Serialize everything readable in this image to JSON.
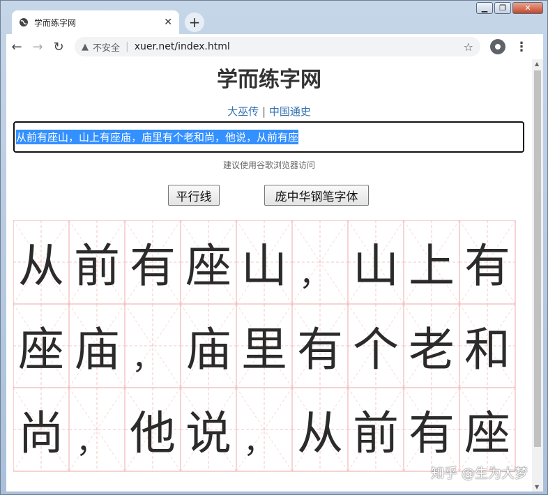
{
  "tab": {
    "title": "学而练字网",
    "close_glyph": "✕"
  },
  "newtab_glyph": "+",
  "window_controls": {
    "minimize": "▁",
    "maximize": "❐",
    "close": "✕"
  },
  "toolbar": {
    "back_glyph": "←",
    "forward_glyph": "→",
    "reload_glyph": "↻",
    "warn_glyph": "▲",
    "insecure_label": "不安全",
    "url": "xuer.net/index.html",
    "star_glyph": "☆",
    "menu_glyph": "⋮"
  },
  "page": {
    "title": "学而练字网",
    "links": [
      {
        "label": "大巫传"
      },
      {
        "label": "中国通史"
      }
    ],
    "link_separator": "|",
    "input_text": "从前有座山，山上有座庙，庙里有个老和尚，他说，从前有座",
    "hint": "建议使用谷歌浏览器访问",
    "buttons": {
      "parallel": "平行线",
      "font": "庞中华钢笔字体"
    }
  },
  "practice_grid": {
    "rows": [
      [
        "从",
        "前",
        "有",
        "座",
        "山",
        "，",
        "山",
        "上",
        "有"
      ],
      [
        "座",
        "庙",
        "，",
        "庙",
        "里",
        "有",
        "个",
        "老",
        "和"
      ],
      [
        "尚",
        "，",
        "他",
        "说",
        "，",
        "从",
        "前",
        "有",
        "座"
      ]
    ],
    "line_color": "#f2b8b8"
  },
  "watermark": "知乎 @生为大梦",
  "colors": {
    "link": "#3572b0",
    "selection": "#3390ff"
  }
}
